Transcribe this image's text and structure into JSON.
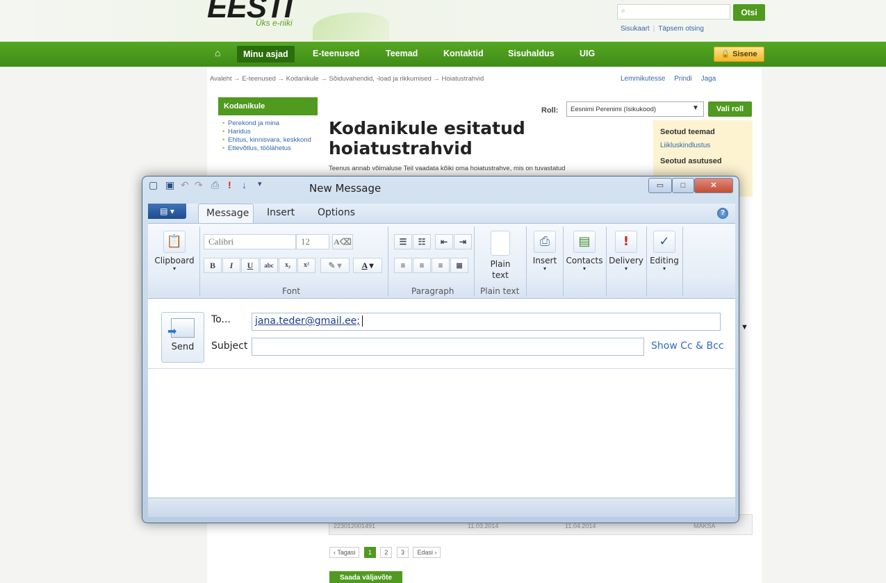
{
  "site": {
    "logo": "EESTI",
    "logo_sub": "Üks e-riiki",
    "search_placeholder": "",
    "search_button": "Otsi",
    "links": [
      "Sisukaart",
      "Täpsem otsing"
    ],
    "nav": [
      "Minu asjad",
      "E-teenused",
      "Teemad",
      "Kontaktid",
      "Sisuhaldus",
      "UIG"
    ],
    "signin": "Sisene",
    "breadcrumb": "Avaleht → E-teenused → Kodanikule → Sõiduvahendid, -load ja rikkumised → Hoiatustrahvid",
    "tools": [
      "Lemmikutesse",
      "Prindi",
      "Jaga"
    ],
    "sidebar_title": "Kodanikule",
    "sidebar_items": [
      "Perekond ja mina",
      "Haridus",
      "Ehitus, kinnisvara, keskkond",
      "Ettevõtlus, töölähetus"
    ],
    "role_label": "Roll:",
    "role_value": "Eesnimi Perenimi (Isikukood)",
    "role_button": "Vali roll",
    "title": "Kodanikule esitatud hoiatustrahvid",
    "intro": "Teenus annab võimaluse Teil vaadata kõiki oma hoiatustrahve, mis on tuvastatud",
    "related_title": "Seotud teemad",
    "related_link": "Liikluskindlustus",
    "related_title2": "Seotud asutused",
    "table_row": [
      "223012001491",
      "11.03.2014",
      "11.04.2014",
      "MAKSA"
    ],
    "pager_prev": "‹ Tagasi",
    "pages": [
      "1",
      "2",
      "3"
    ],
    "pager_next": "Edasi ›",
    "extract_button": "Saada väljavõte"
  },
  "outlook": {
    "title": "New Message",
    "tabs": [
      "Message",
      "Insert",
      "Options"
    ],
    "font_name": "Calibri",
    "font_size": "12",
    "groups": {
      "clipboard": "Clipboard",
      "font": "Font",
      "paragraph": "Paragraph",
      "plain_text_group": "Plain text",
      "plain_text_btn": "Plain text",
      "insert": "Insert",
      "contacts": "Contacts",
      "delivery": "Delivery",
      "editing": "Editing"
    },
    "send": "Send",
    "to_label": "To...",
    "to_value": "jana.teder@gmail.ee;",
    "subject_label": "Subject",
    "subject_value": "",
    "show_cc": "Show Cc & Bcc"
  }
}
